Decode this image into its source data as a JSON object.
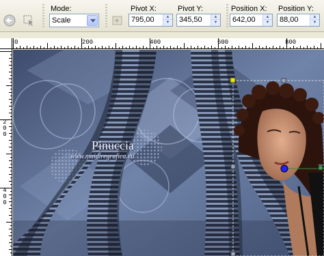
{
  "toolbar": {
    "mode_label": "Mode:",
    "mode_value": "Scale",
    "pivot_x_label": "Pivot X:",
    "pivot_x_value": "795,00",
    "pivot_y_label": "Pivot Y:",
    "pivot_y_value": "345,50",
    "position_x_label": "Position X:",
    "position_x_value": "642,00",
    "position_y_label": "Position Y:",
    "position_y_value": "88,00"
  },
  "ruler": {
    "horizontal": [
      "0",
      "200",
      "400",
      "600",
      "800"
    ],
    "vertical": [
      "200",
      "400"
    ]
  },
  "canvas": {
    "watermark_title": "Pinuccia",
    "watermark_url": "www.maidiregrafica.eu"
  },
  "colors": {
    "toolbar_bg": "#ece9d8",
    "canvas_base": "#5a6f96",
    "canvas_dark": "#1c2233",
    "selection_handle": "#e8e800",
    "pivot_point": "#2222ff"
  },
  "icons": {
    "reset": "circle-arrow-icon",
    "pick": "pick-tool-icon",
    "apply": "apply-icon"
  }
}
